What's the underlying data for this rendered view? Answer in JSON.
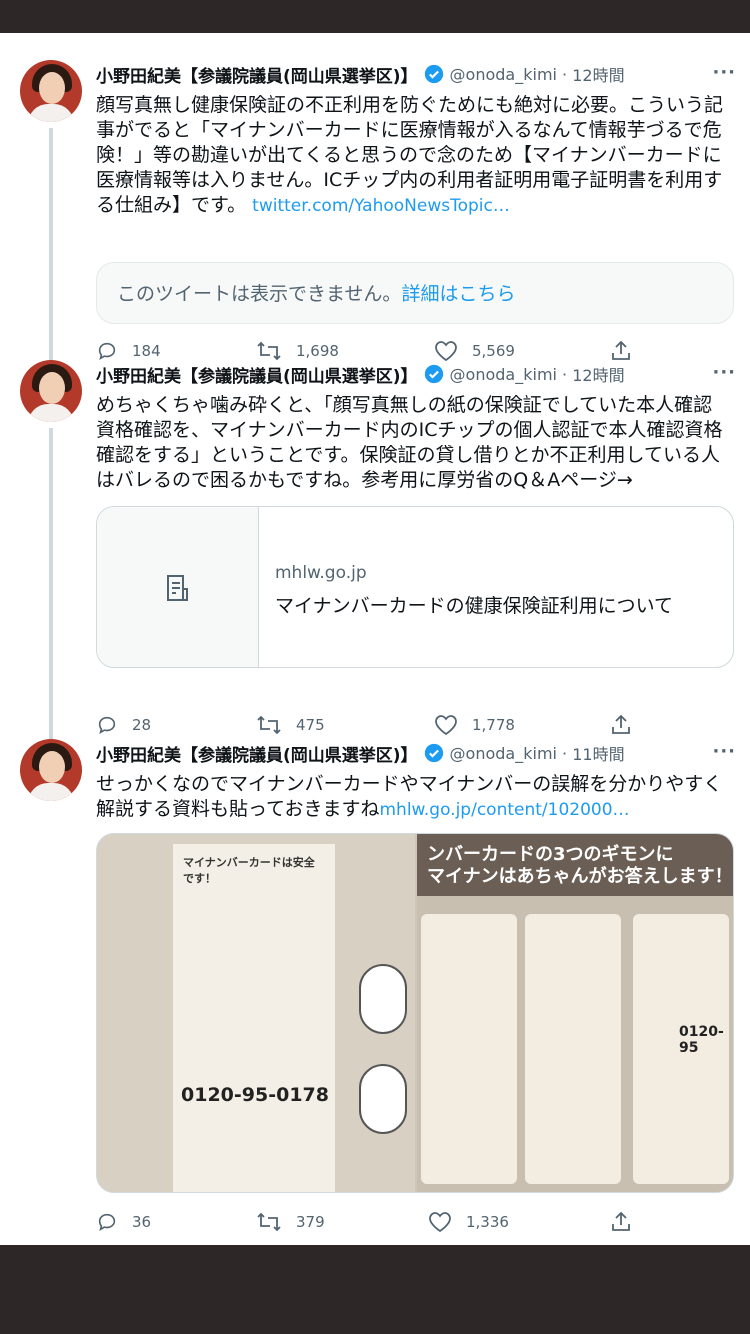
{
  "author": {
    "name": "小野田紀美【参議院議員(岡山県選挙区)】",
    "handle": "@onoda_kimi"
  },
  "tweets": [
    {
      "time": "12時間",
      "text": "顔写真無し健康保険証の不正利用を防ぐためにも絶対に必要。こういう記事がでると「マイナンバーカードに医療情報が入るなんて情報芋づるで危険！」等の勘違いが出てくると思うので念のため【マイナンバーカードに医療情報等は入りません。ICチップ内の利用者証明用電子証明書を利用する仕組み】です。",
      "link": "twitter.com/YahooNewsTopic…",
      "quote_unavailable": "このツイートは表示できません。",
      "quote_more": "詳細はこちら",
      "replies": "184",
      "retweets": "1,698",
      "likes": "5,569"
    },
    {
      "time": "12時間",
      "text": "めちゃくちゃ噛み砕くと、「顔写真無しの紙の保険証でしていた本人確認資格確認を、マイナンバーカード内のICチップの個人認証で本人確認資格確認をする」ということです。保険証の貸し借りとか不正利用している人はバレるので困るかもですね。参考用に厚労省のQ＆Aページ→",
      "card_domain": "mhlw.go.jp",
      "card_title": "マイナンバーカードの健康保険証利用について",
      "card_icon": "document-icon",
      "replies": "28",
      "retweets": "475",
      "likes": "1,778"
    },
    {
      "time": "11時間",
      "text": "せっかくなのでマイナンバーカードやマイナンバーの誤解を分かりやすく解説する資料も貼っておきますね",
      "link": "mhlw.go.jp/content/102000…",
      "media_left_heading": "マイナンバーカードは安全です！",
      "media_left_phone": "0120-95-0178",
      "media_right_heading": "ンバーカードの3つのギモンに\nマイナンはあちゃんがお答えします！",
      "media_right_phone": "0120-95",
      "replies": "36",
      "retweets": "379",
      "likes": "1,336"
    }
  ],
  "colors": {
    "link": "#1d9bf0",
    "muted": "#536471",
    "verified": "#1d9bf0",
    "frame": "#2e2727"
  },
  "icons": [
    "reply-icon",
    "retweet-icon",
    "like-icon",
    "share-icon",
    "verified-icon",
    "more-icon",
    "document-icon"
  ]
}
